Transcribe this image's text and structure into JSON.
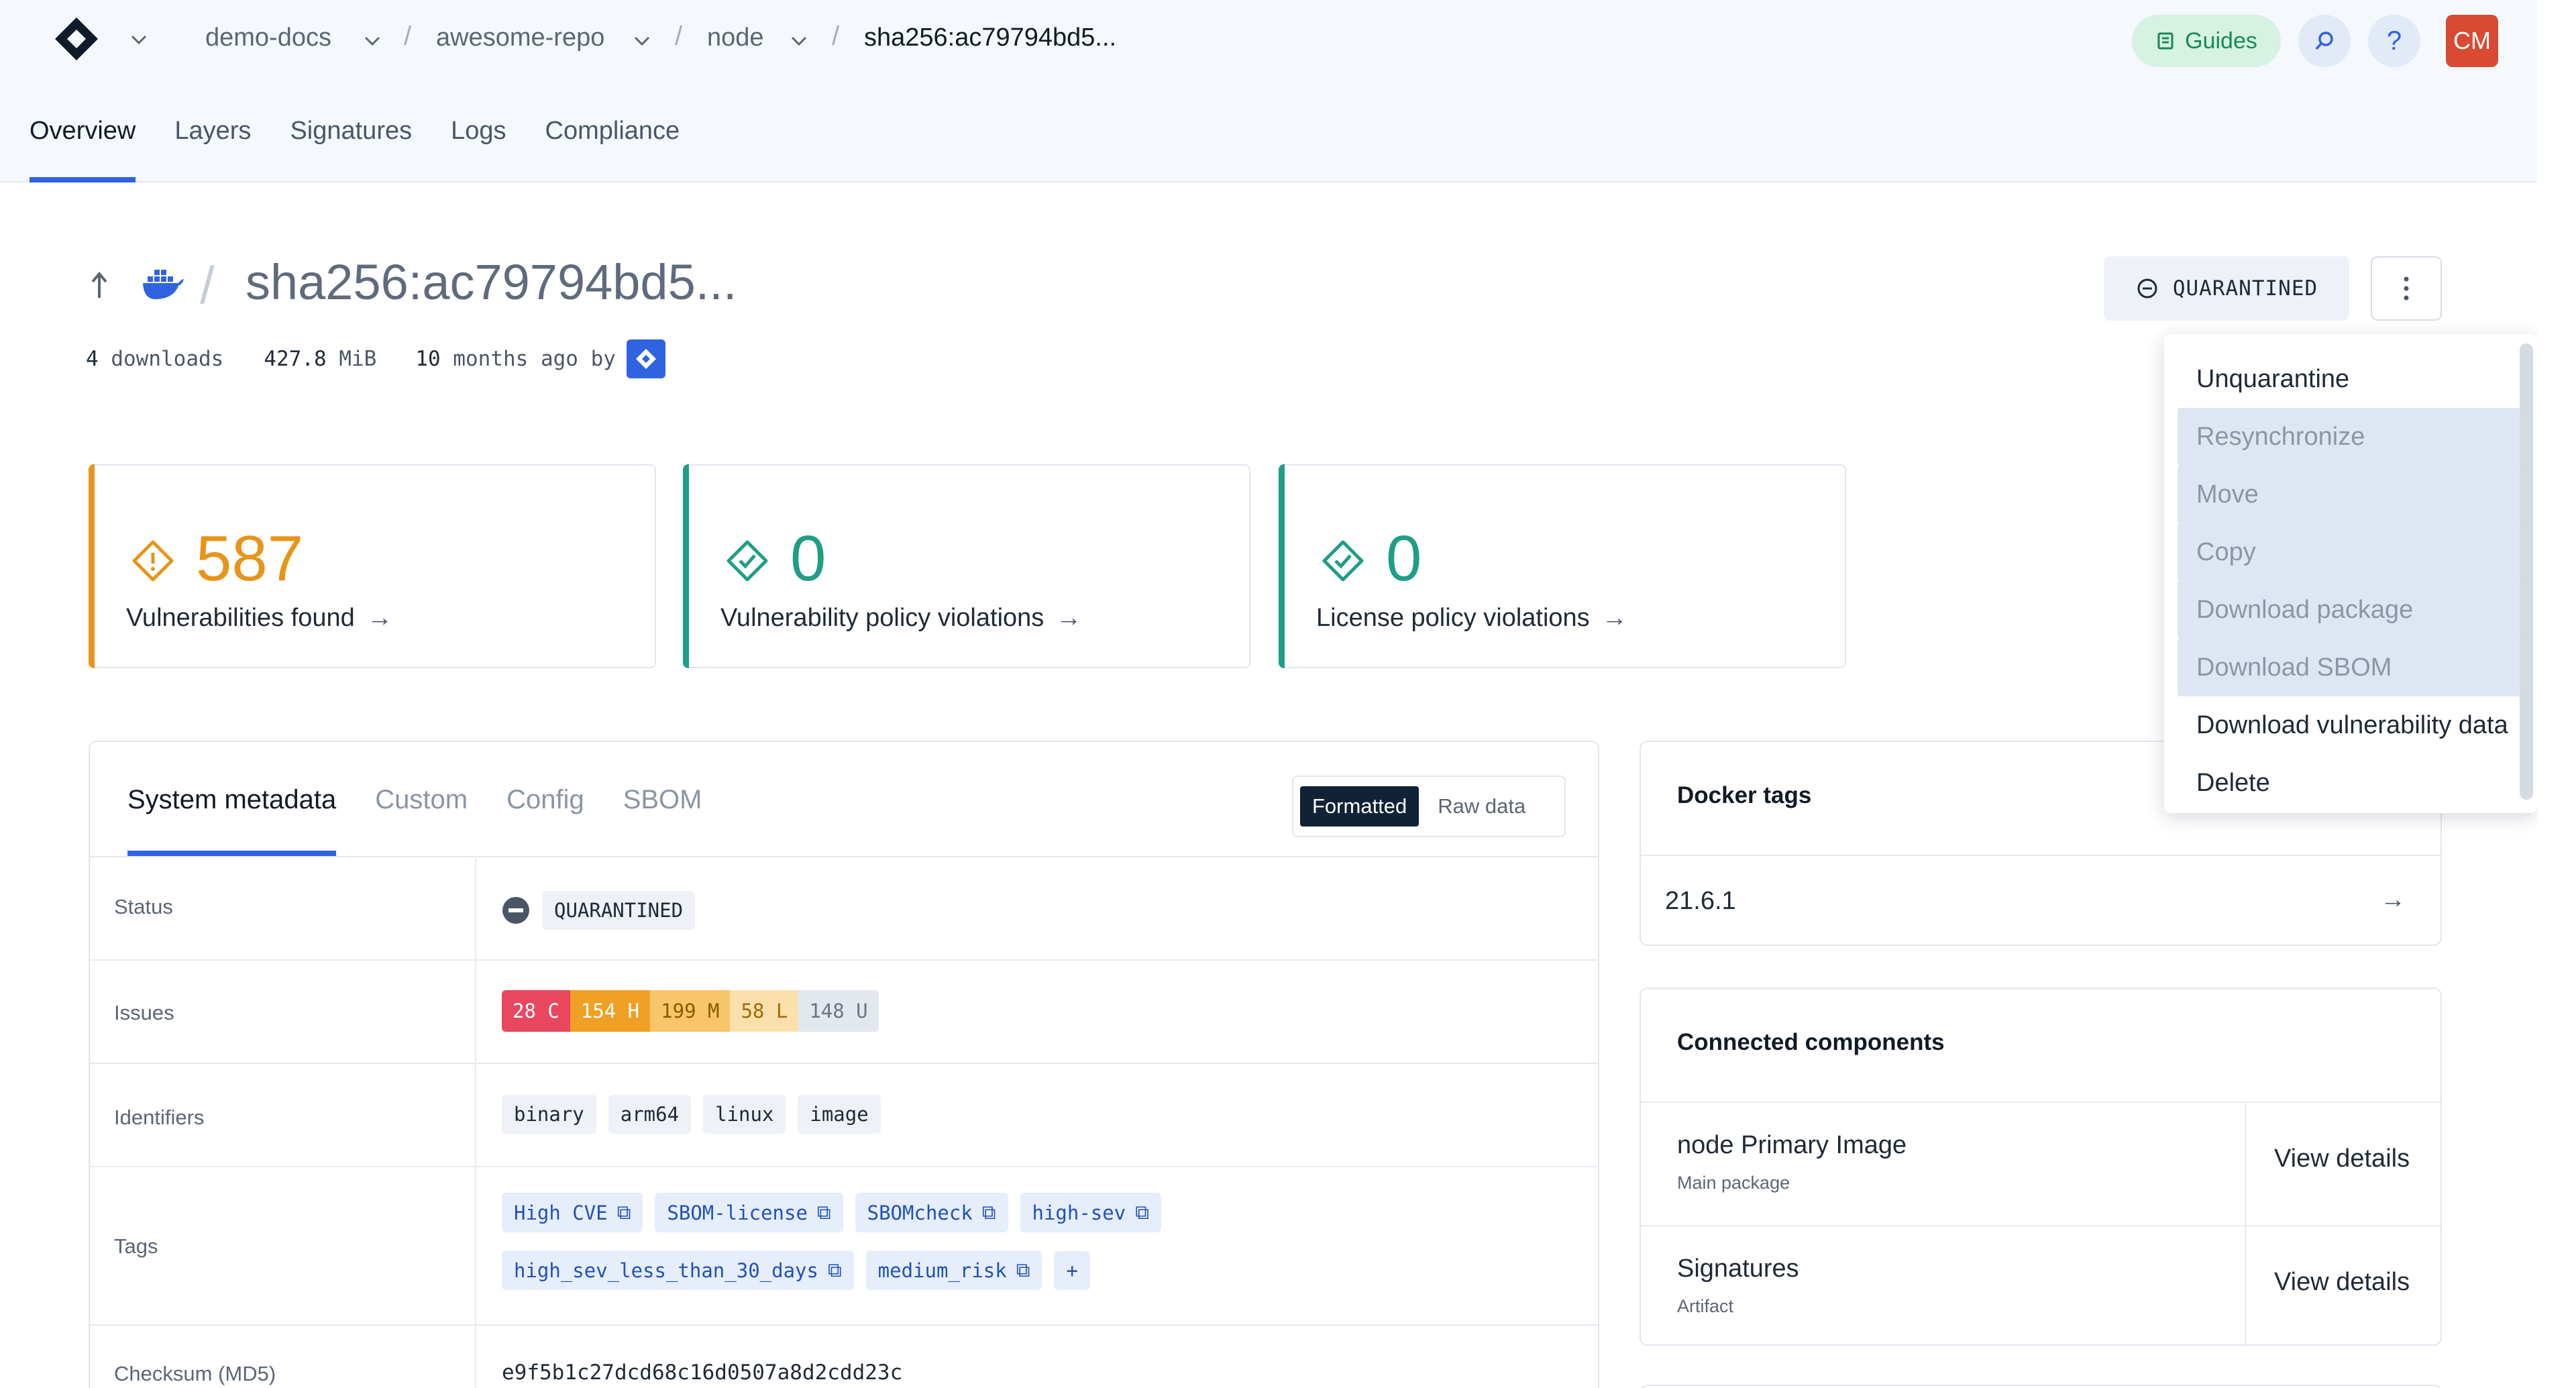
{
  "header": {
    "breadcrumbs": [
      "demo-docs",
      "awesome-repo",
      "node",
      "sha256:ac79794bd5..."
    ],
    "guides_label": "Guides",
    "avatar_initials": "CM"
  },
  "tabs": [
    "Overview",
    "Layers",
    "Signatures",
    "Logs",
    "Compliance"
  ],
  "package": {
    "title": "sha256:ac79794bd5...",
    "downloads_count": "4",
    "downloads_label": "downloads",
    "size": "427.8",
    "size_unit": "MiB",
    "age_count": "10",
    "age_label": "months ago by",
    "status_button": "QUARANTINED"
  },
  "stats": [
    {
      "value": "587",
      "label": "Vulnerabilities found",
      "color": "#e8941a"
    },
    {
      "value": "0",
      "label": "Vulnerability policy violations",
      "color": "#1f9e86"
    },
    {
      "value": "0",
      "label": "License policy violations",
      "color": "#1f9e86"
    }
  ],
  "metadata": {
    "tabs": [
      "System metadata",
      "Custom",
      "Config",
      "SBOM"
    ],
    "toggle": {
      "on": "Formatted",
      "off": "Raw data"
    },
    "rows": {
      "status": {
        "label": "Status",
        "value": "QUARANTINED"
      },
      "issues": {
        "label": "Issues",
        "items": [
          {
            "text": "28 C",
            "bg": "#e8475f",
            "fg": "#ffffff"
          },
          {
            "text": "154 H",
            "bg": "#f0a024",
            "fg": "#ffffff"
          },
          {
            "text": "199 M",
            "bg": "#f8c56a",
            "fg": "#8a5a00"
          },
          {
            "text": "58 L",
            "bg": "#fbe0ad",
            "fg": "#a06b00"
          },
          {
            "text": "148 U",
            "bg": "#e3e8ef",
            "fg": "#6a7585"
          }
        ]
      },
      "identifiers": {
        "label": "Identifiers",
        "items": [
          "binary",
          "arm64",
          "linux",
          "image"
        ]
      },
      "tags": {
        "label": "Tags",
        "items": [
          "High CVE",
          "SBOM-license",
          "SBOMcheck",
          "high-sev",
          "high_sev_less_than_30_days",
          "medium_risk"
        ],
        "add": "+"
      },
      "checksum": {
        "label": "Checksum (MD5)",
        "value": "e9f5b1c27dcd68c16d0507a8d2cdd23c"
      }
    }
  },
  "docker_tags": {
    "title": "Docker tags",
    "value": "21.6.1"
  },
  "connected": {
    "title": "Connected components",
    "items": [
      {
        "name": "node Primary Image",
        "sub": "Main package",
        "action": "View details"
      },
      {
        "name": "Signatures",
        "sub": "Artifact",
        "action": "View details"
      }
    ]
  },
  "menu": {
    "items": [
      {
        "label": "Unquarantine",
        "disabled": false
      },
      {
        "label": "Resynchronize",
        "disabled": true
      },
      {
        "label": "Move",
        "disabled": true
      },
      {
        "label": "Copy",
        "disabled": true
      },
      {
        "label": "Download package",
        "disabled": true
      },
      {
        "label": "Download SBOM",
        "disabled": true
      },
      {
        "label": "Download vulnerability data",
        "disabled": false
      },
      {
        "label": "Delete",
        "disabled": false
      }
    ]
  }
}
